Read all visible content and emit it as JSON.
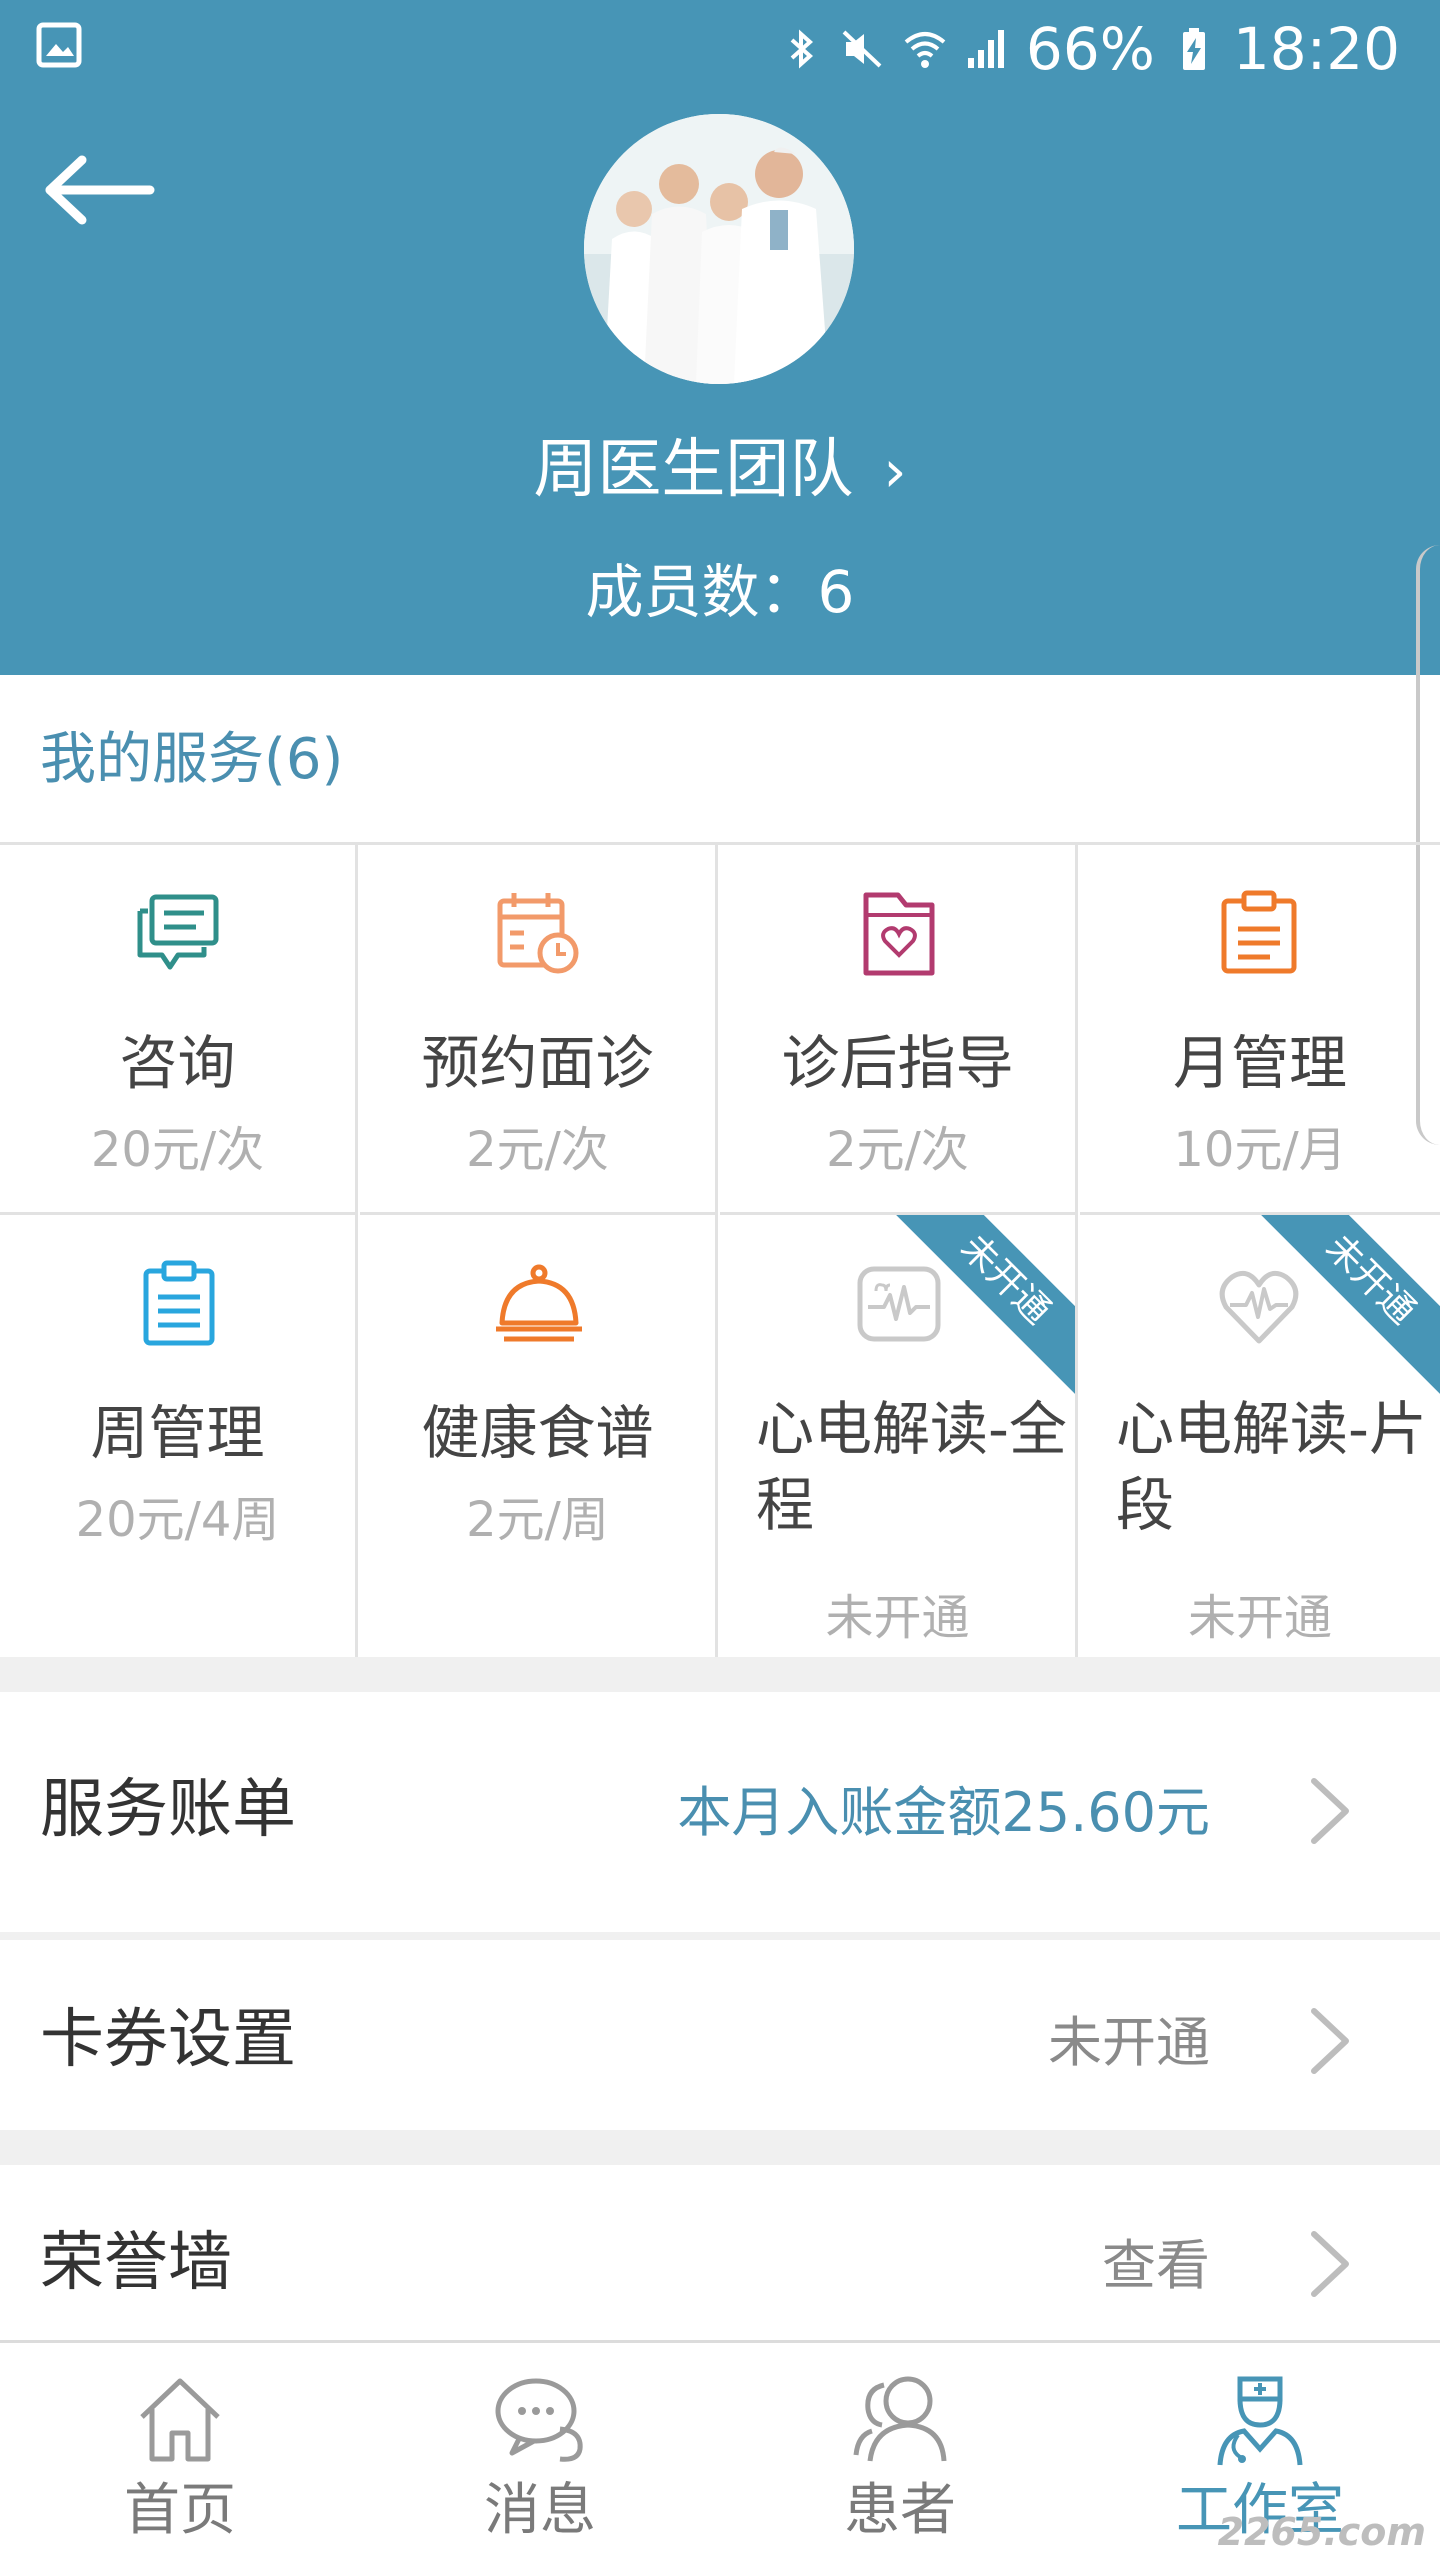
{
  "status_bar": {
    "battery": "66%",
    "time": "18:20",
    "icons": [
      "image-icon",
      "bluetooth-icon",
      "mute-icon",
      "wifi-icon",
      "signal-icon",
      "battery-charging-icon"
    ]
  },
  "header": {
    "team_name": "周医生团队",
    "member_count": "成员数：6",
    "back_icon": "back-arrow-icon",
    "chevron": "›"
  },
  "services": {
    "title": "我的服务(6)",
    "items": [
      {
        "name": "咨询",
        "price": "20元/次",
        "icon": "chat-icon",
        "color": "#2f8f8a"
      },
      {
        "name": "预约面诊",
        "price": "2元/次",
        "icon": "calendar-clock-icon",
        "color": "#f29a6a"
      },
      {
        "name": "诊后指导",
        "price": "2元/次",
        "icon": "folder-heart-icon",
        "color": "#b23b6f"
      },
      {
        "name": "月管理",
        "price": "10元/月",
        "icon": "clipboard-icon",
        "color": "#ef7a2b"
      },
      {
        "name": "周管理",
        "price": "20元/4周",
        "icon": "clipboard-list-icon",
        "color": "#29a6de"
      },
      {
        "name": "健康食谱",
        "price": "2元/周",
        "icon": "cloche-icon",
        "color": "#ef7a2b"
      },
      {
        "name": "心电解读-全程",
        "price": "未开通",
        "icon": "ecg-monitor-icon",
        "color": "#c9c9c9",
        "ribbon": "未开通"
      },
      {
        "name": "心电解读-片段",
        "price": "未开通",
        "icon": "heart-ecg-icon",
        "color": "#c9c9c9",
        "ribbon": "未开通"
      }
    ]
  },
  "rows": [
    {
      "label": "服务账单",
      "value": "本月入账金额25.60元"
    },
    {
      "label": "卡券设置",
      "value": "未开通"
    },
    {
      "label": "荣誉墙",
      "value": "查看"
    }
  ],
  "nav": [
    {
      "label": "首页",
      "icon": "home-icon",
      "active": false
    },
    {
      "label": "消息",
      "icon": "message-icon",
      "active": false
    },
    {
      "label": "患者",
      "icon": "patients-icon",
      "active": false
    },
    {
      "label": "工作室",
      "icon": "doctor-studio-icon",
      "active": true
    }
  ],
  "watermark": "2265.com",
  "colors": {
    "header_bg": "#4795b6",
    "accent": "#4a8fb0"
  }
}
